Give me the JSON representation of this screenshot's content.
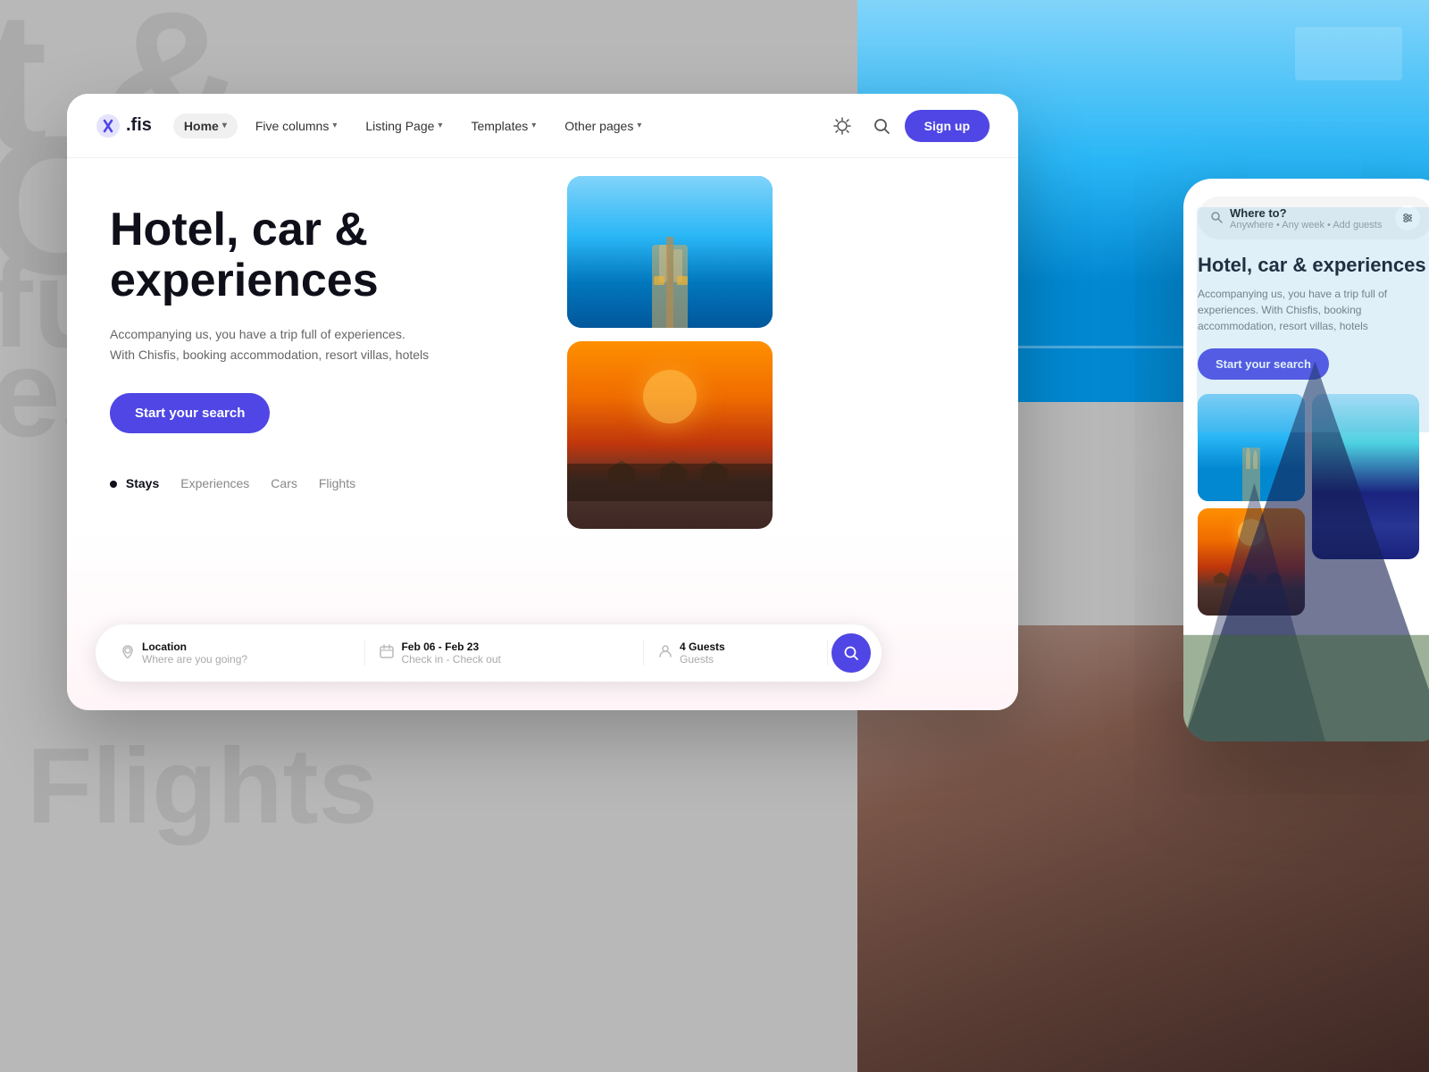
{
  "background": {
    "text1": "t &",
    "text2": "C",
    "text3": "eso",
    "text4": "Flights",
    "text_full_c": "full c"
  },
  "navbar": {
    "logo_text": ".fis",
    "nav_items": [
      {
        "label": "Home",
        "active": true,
        "has_chevron": true
      },
      {
        "label": "Five columns",
        "active": false,
        "has_chevron": true
      },
      {
        "label": "Listing Page",
        "active": false,
        "has_chevron": true
      },
      {
        "label": "Templates",
        "active": false,
        "has_chevron": true
      },
      {
        "label": "Other pages",
        "active": false,
        "has_chevron": true
      }
    ],
    "signup_label": "Sign up"
  },
  "hero": {
    "title": "Hotel, car & experiences",
    "subtitle": "Accompanying us, you have a trip full of experiences. With Chisfis, booking accommodation, resort villas, hotels",
    "cta_label": "Start your search",
    "tabs": [
      {
        "label": "Stays",
        "active": true
      },
      {
        "label": "Experiences",
        "active": false
      },
      {
        "label": "Cars",
        "active": false
      },
      {
        "label": "Flights",
        "active": false
      }
    ],
    "search_fields": [
      {
        "label": "Location",
        "placeholder": "Where are you going?",
        "icon": "📍"
      },
      {
        "label": "Feb 06 - Feb 23",
        "placeholder": "Check in - Check out",
        "icon": "📅"
      },
      {
        "label": "4 Guests",
        "placeholder": "Guests",
        "icon": "👤"
      }
    ]
  },
  "mobile": {
    "search_bar": {
      "main": "Where to?",
      "sub": "Anywhere • Any week • Add guests"
    },
    "title": "Hotel, car & experiences",
    "subtitle": "Accompanying us, you have a trip full of experiences. With Chisfis, booking accommodation, resort villas, hotels",
    "cta_label": "Start your search"
  }
}
